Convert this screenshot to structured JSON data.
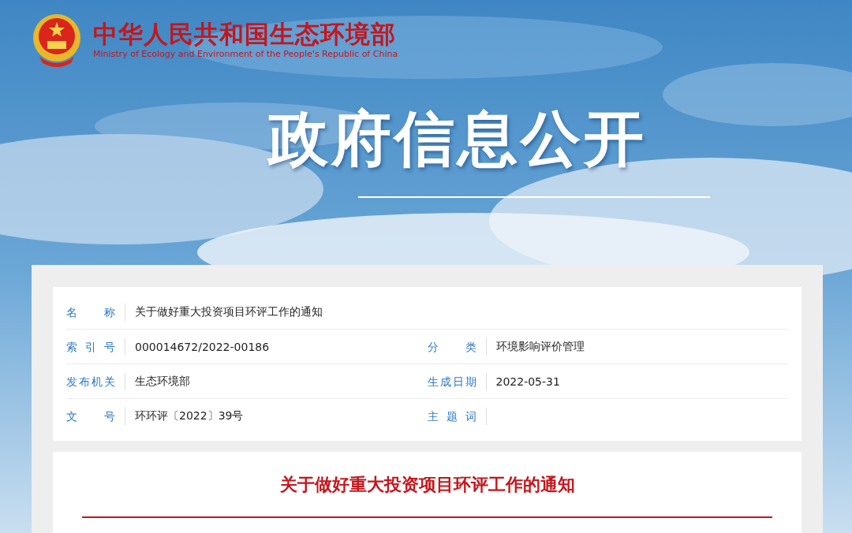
{
  "header": {
    "name_cn": "中华人民共和国生态环境部",
    "name_en": "Ministry of Ecology and Environment of the People's Republic of China"
  },
  "banner": {
    "title": "政府信息公开"
  },
  "info": {
    "rows": [
      [
        {
          "label": "名称",
          "value": "关于做好重大投资项目环评工作的通知"
        }
      ],
      [
        {
          "label": "索引号",
          "value": "000014672/2022-00186"
        },
        {
          "label": "分类",
          "value": "环境影响评价管理"
        }
      ],
      [
        {
          "label": "发布机关",
          "value": "生态环境部"
        },
        {
          "label": "生成日期",
          "value": "2022-05-31"
        }
      ],
      [
        {
          "label": "文号",
          "value": "环环评〔2022〕39号"
        },
        {
          "label": "主题词"
        }
      ]
    ]
  },
  "article": {
    "title": "关于做好重大投资项目环评工作的通知"
  }
}
